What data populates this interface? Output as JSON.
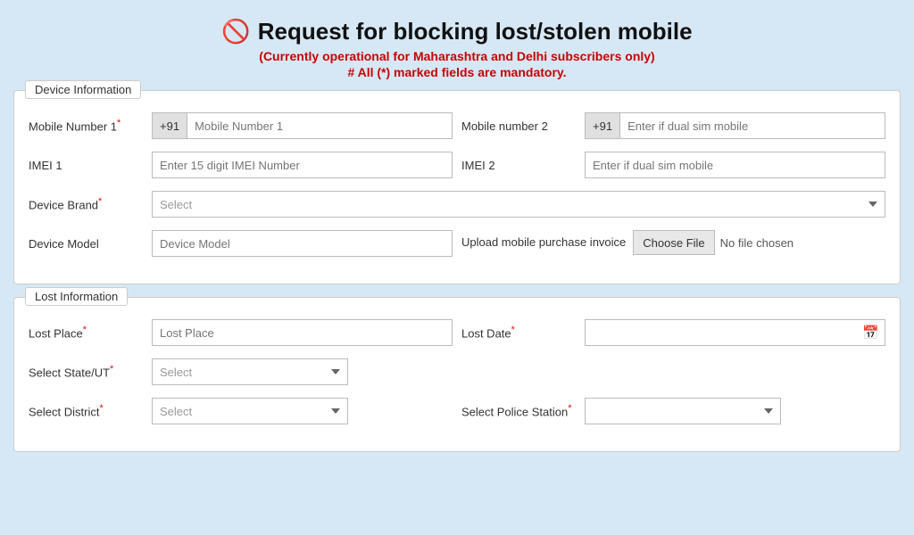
{
  "header": {
    "icon": "🚫",
    "title": "Request for blocking lost/stolen mobile",
    "subtitle1": "(Currently operational for Maharashtra and Delhi subscribers only)",
    "subtitle2": "# All (*) marked fields are mandatory."
  },
  "device_section": {
    "legend": "Device Information",
    "mobile1_label": "Mobile Number 1",
    "mobile1_required": true,
    "mobile1_prefix": "+91",
    "mobile1_placeholder": "Mobile Number 1",
    "mobile2_label": "Mobile number 2",
    "mobile2_prefix": "+91",
    "mobile2_placeholder": "Enter if dual sim mobile",
    "imei1_label": "IMEI 1",
    "imei1_placeholder": "Enter 15 digit IMEI Number",
    "imei2_label": "IMEI 2",
    "imei2_placeholder": "Enter if dual sim mobile",
    "brand_label": "Device Brand",
    "brand_required": true,
    "brand_placeholder": "Select",
    "model_label": "Device Model",
    "model_placeholder": "Device Model",
    "upload_label": "Upload mobile purchase invoice",
    "upload_btn": "Choose File",
    "upload_no_file": "No file chosen"
  },
  "lost_section": {
    "legend": "Lost Information",
    "lost_place_label": "Lost Place",
    "lost_place_required": true,
    "lost_place_placeholder": "Lost Place",
    "lost_date_label": "Lost Date",
    "lost_date_required": true,
    "state_label": "Select State/UT",
    "state_required": true,
    "state_placeholder": "Select",
    "district_label": "Select District",
    "district_required": true,
    "district_placeholder": "Select",
    "police_label": "Select Police Station",
    "police_required": true
  }
}
